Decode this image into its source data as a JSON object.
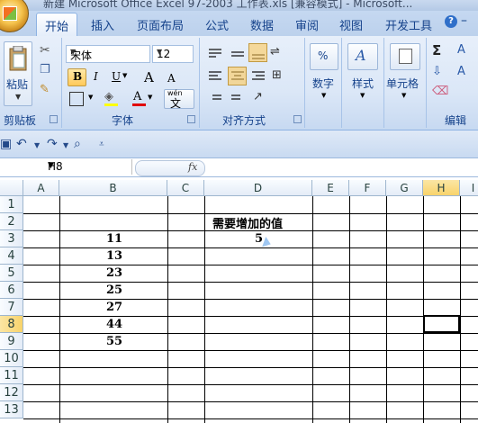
{
  "window": {
    "title": "新建 Microsoft Office Excel 97-2003 工作表.xls [兼容模式] - Microsoft..."
  },
  "tabs": [
    "开始",
    "插入",
    "页面布局",
    "公式",
    "数据",
    "审阅",
    "视图",
    "开发工具"
  ],
  "ribbon": {
    "clipboard": {
      "paste": "粘贴",
      "label": "剪贴板"
    },
    "font": {
      "name": "宋体",
      "size": "12",
      "bold": "B",
      "italic": "I",
      "underline": "U",
      "grow": "A",
      "shrink": "A",
      "phonetic": "wén",
      "phonetic_char": "文",
      "label": "字体"
    },
    "alignment": {
      "label": "对齐方式"
    },
    "number": {
      "button": "数字",
      "label": ""
    },
    "styles": {
      "button": "样式"
    },
    "cells": {
      "button": "单元格"
    },
    "editing": {
      "sum": "Σ",
      "sort": "A",
      "find": "A",
      "label": "编辑"
    }
  },
  "formula_bar": {
    "name_box": "H8",
    "fx": "fx",
    "value": ""
  },
  "sheet": {
    "columns": [
      "A",
      "B",
      "C",
      "D",
      "E",
      "F",
      "G",
      "H",
      "I"
    ],
    "rows": [
      "1",
      "2",
      "3",
      "4",
      "5",
      "6",
      "7",
      "8",
      "9",
      "10",
      "11",
      "12",
      "13"
    ],
    "cells": {
      "D2": "需要增加的值",
      "D3": "5",
      "B3": "11",
      "B4": "13",
      "B5": "23",
      "B6": "25",
      "B7": "27",
      "B8": "44",
      "B9": "55"
    }
  }
}
